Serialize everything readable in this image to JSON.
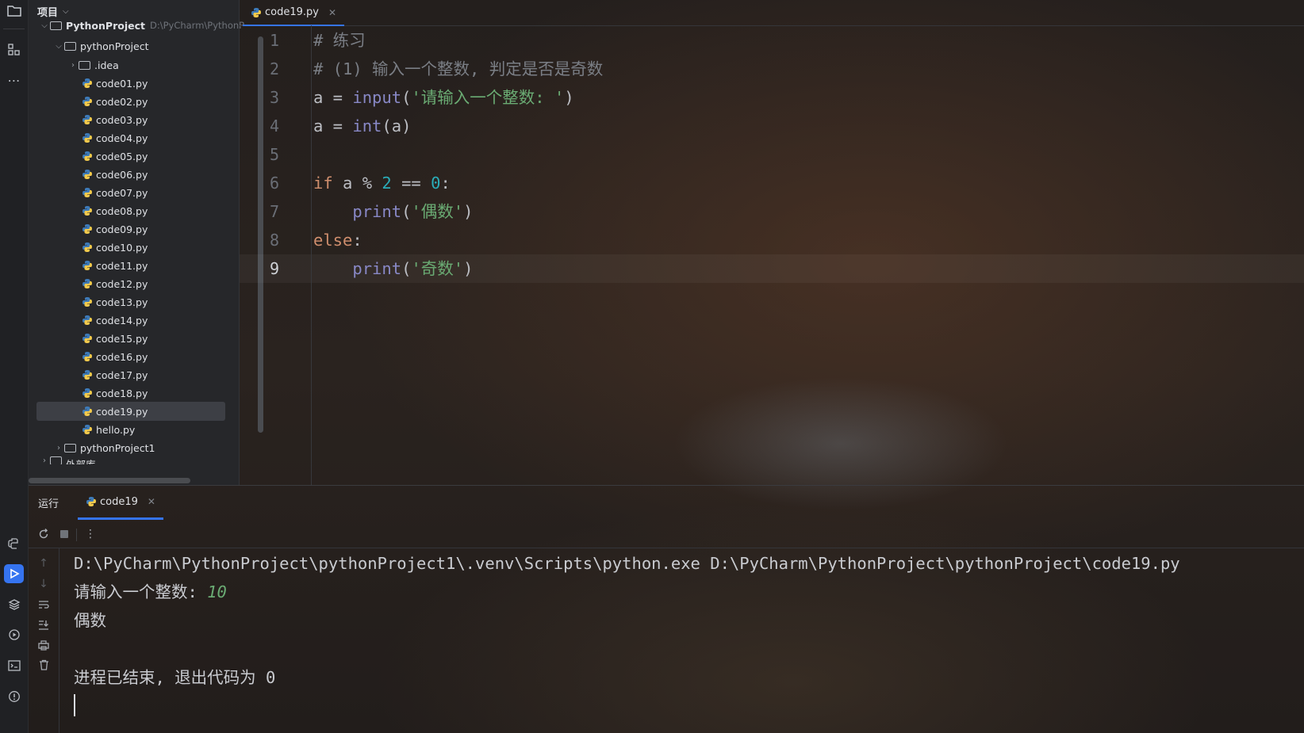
{
  "project_panel": {
    "title": "项目",
    "root": {
      "label": "PythonProject",
      "hint": "D:\\PyCharm\\PythonP"
    },
    "folder": "pythonProject",
    "idea": ".idea",
    "files": [
      "code01.py",
      "code02.py",
      "code03.py",
      "code04.py",
      "code05.py",
      "code06.py",
      "code07.py",
      "code08.py",
      "code09.py",
      "code10.py",
      "code11.py",
      "code12.py",
      "code13.py",
      "code14.py",
      "code15.py",
      "code16.py",
      "code17.py",
      "code18.py",
      "code19.py",
      "hello.py"
    ],
    "selected_file": "code19.py",
    "folder2": "pythonProject1",
    "external_libs": "外部库"
  },
  "editor": {
    "tab_label": "code19.py",
    "current_line": 9,
    "line_numbers": [
      "1",
      "2",
      "3",
      "4",
      "5",
      "6",
      "7",
      "8",
      "9"
    ],
    "code": {
      "l1": "# 练习",
      "l2": "# (1) 输入一个整数, 判定是否是奇数",
      "l3_var": "a",
      "l3_eq": " = ",
      "l3_fn": "input",
      "l3_open": "(",
      "l3_str": "'请输入一个整数: '",
      "l3_close": ")",
      "l4_var": "a",
      "l4_eq": " = ",
      "l4_fn": "int",
      "l4_rest": "(a)",
      "l6_kw": "if",
      "l6_mid": " a % ",
      "l6_n1": "2",
      "l6_op": " == ",
      "l6_n2": "0",
      "l6_colon": ":",
      "l7_indent": "    ",
      "l7_fn": "print",
      "l7_open": "(",
      "l7_str": "'偶数'",
      "l7_close": ")",
      "l8_kw": "else",
      "l8_colon": ":",
      "l9_indent": "    ",
      "l9_fn": "print",
      "l9_open": "(",
      "l9_str": "'奇数'",
      "l9_close": ")"
    }
  },
  "run_panel": {
    "title": "运行",
    "tab_label": "code19",
    "output": {
      "command": "D:\\PyCharm\\PythonProject\\pythonProject1\\.venv\\Scripts\\python.exe D:\\PyCharm\\PythonProject\\pythonProject\\code19.py",
      "prompt": "请输入一个整数: ",
      "input_value": "10",
      "result": "偶数",
      "exit": "进程已结束, 退出代码为 0"
    }
  },
  "colors": {
    "accent": "#3574f0",
    "keyword": "#cf8e6d",
    "string": "#6aab73",
    "number": "#2aacb8",
    "builtin": "#8888c6",
    "comment": "#7a7e85"
  }
}
